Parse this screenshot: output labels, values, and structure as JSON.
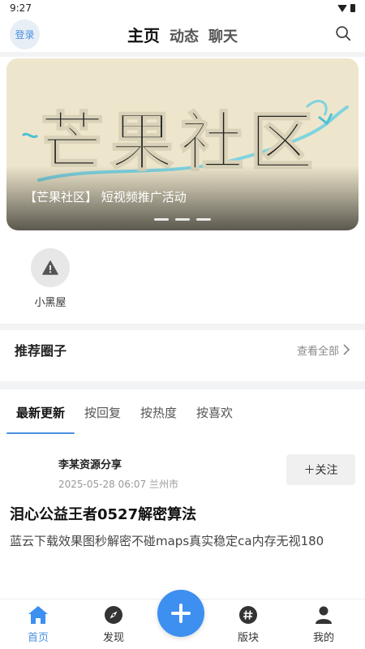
{
  "status_bar": {
    "time": "9:27"
  },
  "header": {
    "login_label": "登录",
    "tabs": [
      {
        "label": "主页",
        "active": true
      },
      {
        "label": "动态",
        "active": false
      },
      {
        "label": "聊天",
        "active": false
      }
    ],
    "search_icon": "search-icon"
  },
  "banner": {
    "art_text": "芒果社区",
    "caption": "【芒果社区】 短视频推广活动",
    "slide_count": 3
  },
  "shortcuts": [
    {
      "label": "小黑屋",
      "icon": "warning-icon"
    }
  ],
  "recommended": {
    "title": "推荐圈子",
    "view_all": "查看全部"
  },
  "sort_tabs": [
    {
      "label": "最新更新",
      "active": true
    },
    {
      "label": "按回复",
      "active": false
    },
    {
      "label": "按热度",
      "active": false
    },
    {
      "label": "按喜欢",
      "active": false
    }
  ],
  "post": {
    "author": "李某资源分享",
    "meta": "2025-05-28 06:07 兰州市",
    "follow_label": "＋关注",
    "title": "泪心公益王者0527解密算法",
    "excerpt": "蓝云下载效果图秒解密不碰maps真实稳定ca内存无视180"
  },
  "bottom_nav": {
    "items": [
      {
        "label": "首页",
        "icon": "home-icon",
        "active": true
      },
      {
        "label": "发现",
        "icon": "compass-icon",
        "active": false
      },
      {
        "label": "版块",
        "icon": "hashtag-icon",
        "active": false
      },
      {
        "label": "我的",
        "icon": "user-icon",
        "active": false
      }
    ],
    "fab_icon": "plus-icon"
  },
  "colors": {
    "accent": "#3d8ff0",
    "login_bg": "#e8eef5"
  }
}
